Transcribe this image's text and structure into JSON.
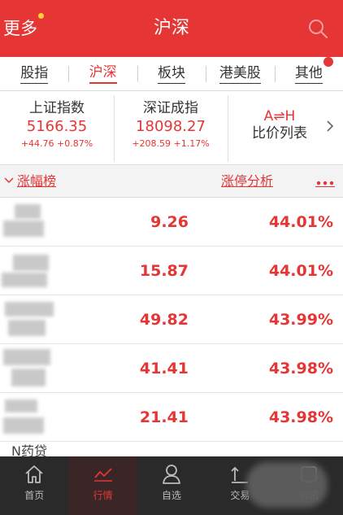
{
  "header": {
    "more_label": "更多",
    "title": "沪深"
  },
  "tabs": [
    {
      "label": "股指"
    },
    {
      "label": "沪深",
      "active": true
    },
    {
      "label": "板块"
    },
    {
      "label": "港美股"
    },
    {
      "label": "其他",
      "badge": true
    }
  ],
  "indices": [
    {
      "name": "上证指数",
      "value": "5166.35",
      "change": "+44.76 +0.87%"
    },
    {
      "name": "深证成指",
      "value": "18098.27",
      "change": "+208.59 +1.17%"
    }
  ],
  "compare": {
    "ah_label": "A⇌H",
    "label": "比价列表"
  },
  "section": {
    "rank_label": "涨幅榜",
    "limit_label": "涨停分析"
  },
  "stocks": [
    {
      "price": "9.26",
      "pct": "44.01%"
    },
    {
      "price": "15.87",
      "pct": "44.01%"
    },
    {
      "price": "49.82",
      "pct": "43.99%"
    },
    {
      "price": "41.41",
      "pct": "43.98%"
    },
    {
      "price": "21.41",
      "pct": "43.98%"
    }
  ],
  "partial_row_name": "N药贷",
  "bottom_nav": [
    {
      "label": "首页",
      "icon": "home-icon"
    },
    {
      "label": "行情",
      "icon": "chart-icon",
      "active": true
    },
    {
      "label": "自选",
      "icon": "person-icon"
    },
    {
      "label": "交易",
      "icon": "trade-icon"
    },
    {
      "label": "资讯",
      "icon": "news-icon"
    }
  ],
  "colors": {
    "accent": "#e63535",
    "header_bg": "#e63535",
    "nav_bg": "#2a2a2a",
    "section_bg": "#f3f3f3"
  }
}
